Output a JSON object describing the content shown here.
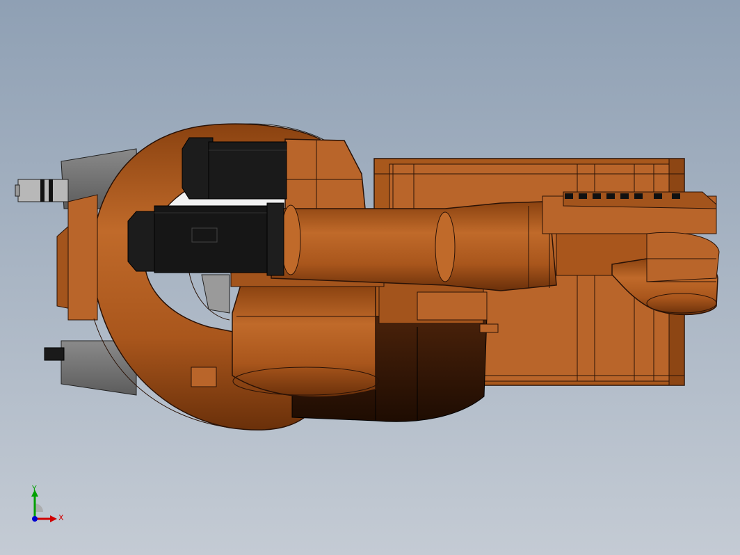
{
  "viewport": {
    "title": "",
    "background_top": "#8fa0b4",
    "background_bottom": "#c4cbd4"
  },
  "model": {
    "body_color": "#b05a1e",
    "motor_color": "#111111",
    "cable_housing_color": "#6e6e6e"
  },
  "triad": {
    "x_label": "X",
    "y_label": "Y",
    "x_color": "#d00000",
    "y_color": "#00a000",
    "z_color": "#0000d0"
  }
}
